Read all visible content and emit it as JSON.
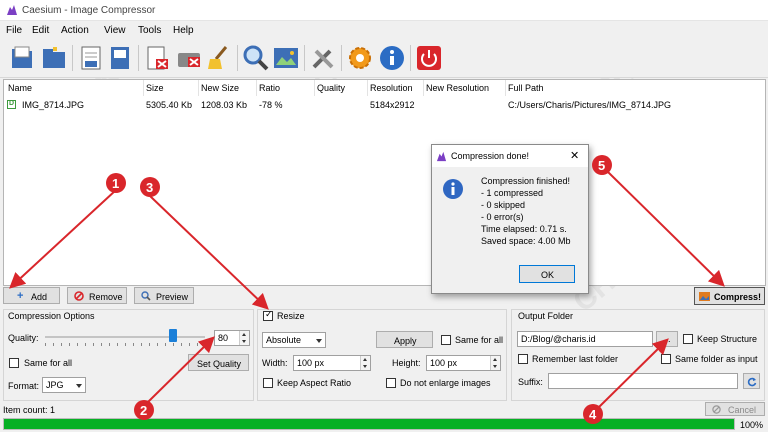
{
  "window": {
    "title": "Caesium - Image Compressor"
  },
  "menu": [
    "File",
    "Edit",
    "Action",
    "View",
    "Tools",
    "Help"
  ],
  "toolbar_icons": [
    "open-file-icon",
    "open-folder-icon",
    "save-list-icon",
    "export-list-icon",
    "remove-item-icon",
    "clear-list-icon",
    "broom-icon",
    "preview-magnifier-icon",
    "compare-image-icon",
    "tools-icon",
    "settings-gear-icon",
    "info-icon",
    "power-exit-icon"
  ],
  "table": {
    "headers": [
      "Name",
      "Size",
      "New Size",
      "Ratio",
      "Quality",
      "Resolution",
      "New Resolution",
      "Full Path"
    ],
    "rows": [
      {
        "name": "IMG_8714.JPG",
        "size": "5305.40 Kb",
        "new_size": "1208.03 Kb",
        "ratio": "-78 %",
        "quality": "",
        "resolution": "5184x2912",
        "new_resolution": "",
        "path": "C:/Users/Charis/Pictures/IMG_8714.JPG"
      }
    ]
  },
  "buttons": {
    "add": "Add",
    "remove": "Remove",
    "preview": "Preview",
    "compress": "Compress!"
  },
  "compression": {
    "title": "Compression Options",
    "quality_label": "Quality:",
    "quality_value": "80",
    "quality_fraction": 0.8,
    "same_for_all": "Same for all",
    "set_quality": "Set Quality",
    "format_label": "Format:",
    "format_value": "JPG"
  },
  "resize": {
    "title": "Resize",
    "checked": true,
    "mode": "Absolute",
    "apply": "Apply",
    "same_for_all": "Same for all",
    "width_label": "Width:",
    "width_value": "100 px",
    "height_label": "Height:",
    "height_value": "100 px",
    "keep_aspect": "Keep Aspect Ratio",
    "no_enlarge": "Do not enlarge images"
  },
  "output": {
    "title": "Output Folder",
    "folder": "D:/Blog/@charis.id",
    "browse": "...",
    "keep_structure": "Keep Structure",
    "remember": "Remember last folder",
    "same_folder": "Same folder as input",
    "suffix_label": "Suffix:",
    "suffix_value": ""
  },
  "dialog": {
    "title": "Compression done!",
    "lines": [
      "Compression finished!",
      "- 1 compressed",
      "- 0 skipped",
      "- 0 error(s)",
      "Time elapsed: 0.71 s.",
      "Saved space: 4.00 Mb"
    ],
    "ok": "OK"
  },
  "status": {
    "item_count": "Item count: 1",
    "cancel": "Cancel",
    "progress_label": "100%",
    "progress_fraction": 1.0
  },
  "annotations": [
    "1",
    "2",
    "3",
    "4",
    "5"
  ],
  "watermark": "CHARIS.ID",
  "colors": {
    "accent_red": "#d9262b",
    "progress_green": "#06b025"
  }
}
